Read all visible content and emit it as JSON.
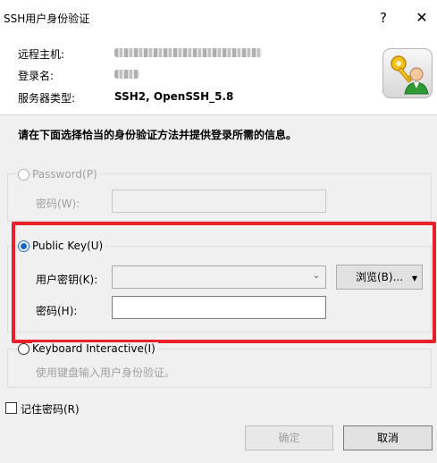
{
  "window": {
    "title": "SSH用户身份验证",
    "help_glyph": "?",
    "close_glyph": "✕"
  },
  "info": {
    "remote_host_label": "远程主机:",
    "login_name_label": "登录名:",
    "server_type_label": "服务器类型:",
    "server_type_value": "SSH2, OpenSSH_5.8",
    "logo_icon": "keys-user-icon"
  },
  "instruction": "请在下面选择恰当的身份验证方法并提供登录所需的信息。",
  "password_section": {
    "radio_label": "Password(P)",
    "field_label": "密码(W):",
    "selected": false,
    "enabled": false
  },
  "publickey_section": {
    "radio_label": "Public Key(U)",
    "user_key_label": "用户密钥(K):",
    "user_key_value": "",
    "browse_label": "浏览(B)...",
    "passphrase_label": "密码(H):",
    "passphrase_value": "",
    "selected": true
  },
  "keyboard_section": {
    "radio_label": "Keyboard Interactive(I)",
    "description": "使用键盘输入用户身份验证。",
    "selected": false
  },
  "remember": {
    "label": "记住密码(R)",
    "checked": false
  },
  "buttons": {
    "ok_label": "确定",
    "cancel_label": "取消"
  },
  "colors": {
    "accent": "#1565c0",
    "highlight": "#e8202a"
  }
}
